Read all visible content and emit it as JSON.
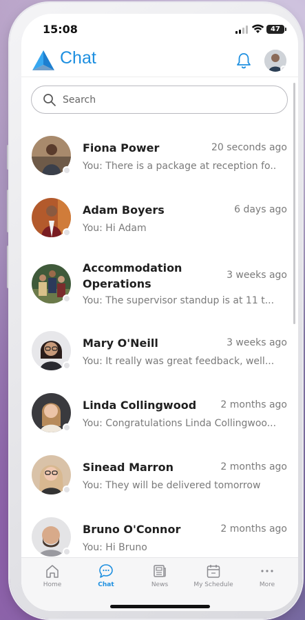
{
  "status_bar": {
    "time": "15:08",
    "battery": "47"
  },
  "header": {
    "title": "Chat",
    "colors": {
      "accent": "#1d8fe0"
    },
    "icons": [
      "app-logo-icon",
      "bell-icon"
    ]
  },
  "search": {
    "placeholder": "Search"
  },
  "chats": [
    {
      "name": "Fiona Power",
      "time": "20 seconds ago",
      "preview": "You: There is a package at reception fo..."
    },
    {
      "name": "Adam Boyers",
      "time": "6 days ago",
      "preview": "You: Hi Adam"
    },
    {
      "name": "Accommodation Operations",
      "time": "3 weeks ago",
      "preview": "You: The supervisor standup is at 11 t..."
    },
    {
      "name": "Mary O'Neill",
      "time": "3 weeks ago",
      "preview": "You: It really was great feedback, well..."
    },
    {
      "name": "Linda Collingwood",
      "time": "2 months ago",
      "preview": "You: Congratulations Linda Collingwoo..."
    },
    {
      "name": "Sinead Marron",
      "time": "2 months ago",
      "preview": "You: They will be delivered tomorrow"
    },
    {
      "name": "Bruno O'Connor",
      "time": "2 months ago",
      "preview": "You: Hi Bruno"
    }
  ],
  "tabs": [
    {
      "label": "Home",
      "icon": "home-icon"
    },
    {
      "label": "Chat",
      "icon": "chat-bubble-icon"
    },
    {
      "label": "News",
      "icon": "newspaper-icon"
    },
    {
      "label": "My Schedule",
      "icon": "calendar-icon"
    },
    {
      "label": "More",
      "icon": "more-dots-icon"
    }
  ]
}
